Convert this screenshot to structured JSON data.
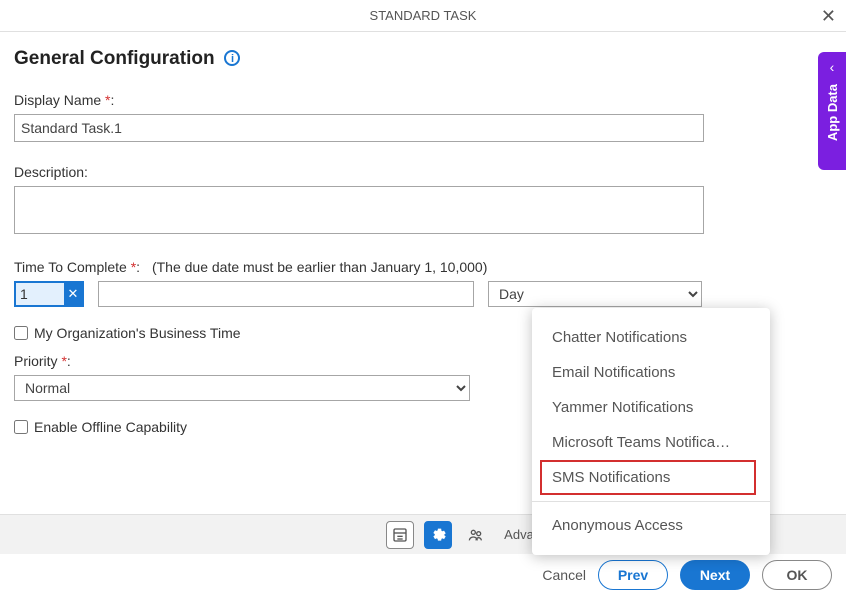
{
  "title": "STANDARD TASK",
  "header": {
    "heading": "General Configuration"
  },
  "labels": {
    "display_name": "Display Name",
    "description": "Description:",
    "time_to_complete": "Time To Complete",
    "time_hint": "(The due date must be earlier than January 1, 10,000)",
    "business_time": "My Organization's Business Time",
    "priority": "Priority",
    "offline": "Enable Offline Capability",
    "colon": ":"
  },
  "values": {
    "display_name": "Standard Task.1",
    "description": "",
    "time_number": "1",
    "time_unit": "Day",
    "priority": "Normal"
  },
  "toolbar": {
    "advanced": "Advanced"
  },
  "footer": {
    "cancel": "Cancel",
    "prev": "Prev",
    "next": "Next",
    "ok": "OK"
  },
  "popup": {
    "items": [
      "Chatter Notifications",
      "Email Notifications",
      "Yammer Notifications",
      "Microsoft Teams Notifica…",
      "SMS Notifications"
    ],
    "footer_item": "Anonymous Access"
  },
  "side_tab": "App Data"
}
